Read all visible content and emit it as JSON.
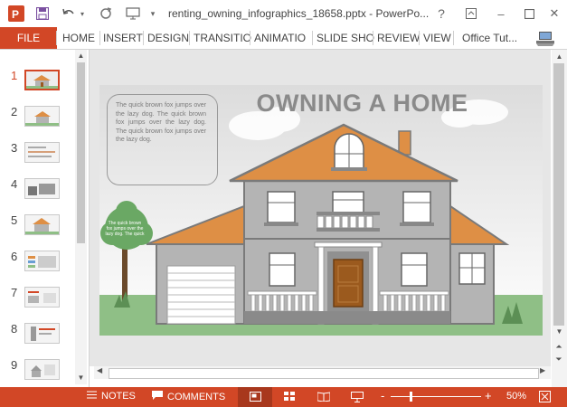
{
  "window": {
    "title": "renting_owning_infographics_18658.pptx - PowerPo...",
    "help_label": "?",
    "min_label": "–",
    "close_label": "✕"
  },
  "ribbon": {
    "file_label": "FILE",
    "tabs": [
      "HOME",
      "INSERT",
      "DESIGN",
      "TRANSITIO",
      "ANIMATIO",
      "SLIDE SHO",
      "REVIEW",
      "VIEW"
    ],
    "account_label": "Office Tut..."
  },
  "thumbnails": {
    "numbers": [
      "1",
      "2",
      "3",
      "4",
      "5",
      "6",
      "7",
      "8",
      "9"
    ],
    "selected": "1"
  },
  "slide": {
    "title": "OWNING A HOME",
    "bubble_text": "The quick brown fox jumps over the lazy dog. The quick brown fox jumps over the lazy dog. The quick brown fox jumps over the lazy dog.",
    "tree_text": "The quick brown fox jumps over the lazy dog. The quick"
  },
  "status": {
    "notes_label": "NOTES",
    "comments_label": "COMMENTS",
    "zoom_label": "50%",
    "zoom_minus": "-",
    "zoom_plus": "+"
  },
  "colors": {
    "accent": "#d24726",
    "roof": "#de8f45",
    "wall": "#b4b4b4",
    "door": "#9b5a1e",
    "grass": "#8fbf86"
  }
}
